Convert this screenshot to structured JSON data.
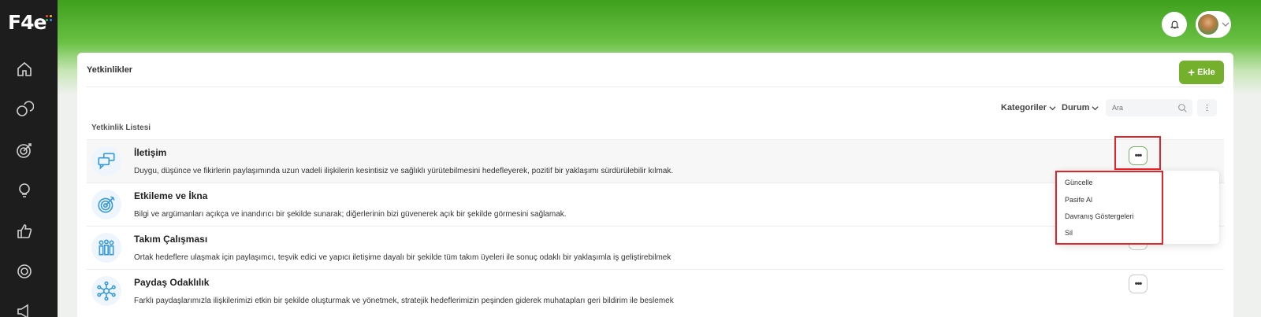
{
  "brand": {
    "logo": "F4e",
    "dot_colors": [
      "#e94b3c",
      "#f4c20d",
      "#3cba54",
      "#4285f4"
    ]
  },
  "sidebar": {
    "items": [
      {
        "name": "home-icon"
      },
      {
        "name": "chat-icon"
      },
      {
        "name": "target-icon"
      },
      {
        "name": "bulb-icon"
      },
      {
        "name": "thumbs-up-icon"
      },
      {
        "name": "settings-icon"
      },
      {
        "name": "megaphone-icon"
      }
    ]
  },
  "header": {
    "bell_icon": "bell-icon"
  },
  "card": {
    "title": "Yetkinlikler",
    "add_label": "Ekle",
    "filters": {
      "category": "Kategoriler",
      "status": "Durum"
    },
    "search_placeholder": "Ara",
    "list_title": "Yetkinlik Listesi"
  },
  "competencies": [
    {
      "name": "İletişim",
      "description": "Duygu, düşünce ve fikirlerin paylaşımında uzun vadeli ilişkilerin kesintisiz ve sağlıklı yürütebilmesini hedefleyerek, pozitif bir yaklaşımı sürdürülebilir kılmak.",
      "icon": "speech-bubbles-icon"
    },
    {
      "name": "Etkileme ve İkna",
      "description": "Bilgi ve argümanları açıkça ve inandırıcı bir şekilde sunarak; diğerlerinin bizi güvenerek açık bir şekilde görmesini sağlamak.",
      "icon": "target-icon"
    },
    {
      "name": "Takım Çalışması",
      "description": "Ortak hedeflere ulaşmak için paylaşımcı, teşvik edici ve yapıcı iletişime dayalı bir şekilde tüm takım üyeleri ile sonuç odaklı bir yaklaşımla iş geliştirebilmek",
      "icon": "team-icon"
    },
    {
      "name": "Paydaş Odaklılık",
      "description": "Farklı paydaşlarımızla ilişkilerimizi etkin bir şekilde oluşturmak ve yönetmek, stratejik hedeflerimizin peşinden giderek muhatapları geri bildirim ile beslemek",
      "icon": "network-icon"
    }
  ],
  "row_actions_label": "•••",
  "dropdown": {
    "items": [
      "Güncelle",
      "Pasife Al",
      "Davranış Göstergeleri",
      "Sil"
    ]
  },
  "colors": {
    "accent": "#74b02c",
    "highlight": "#e0242a",
    "sidebar": "#1d1d1d"
  }
}
